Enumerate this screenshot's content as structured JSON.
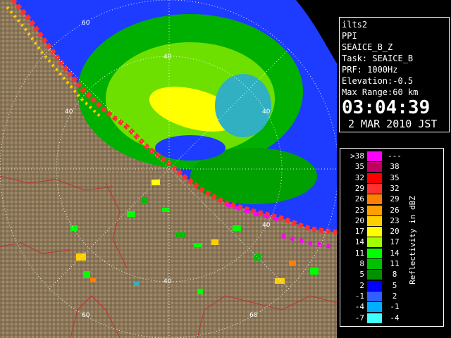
{
  "info": {
    "radar_name": "ilts2",
    "scan_type": "PPI",
    "product": "SEAICE_B_Z",
    "task": "Task: SEAICE_B",
    "prf": "PRF: 1000Hz",
    "elevation": "Elevation:-0.5",
    "max_range": "Max Range:60 km",
    "time": "03:04:39",
    "date": "2 MAR 2010 JST"
  },
  "range_rings": {
    "labels": [
      "60",
      "40",
      "40",
      "40",
      "40",
      "60",
      "60"
    ]
  },
  "legend": {
    "unit_label": "Reflectivity in dBZ",
    "rows": [
      {
        "lo": ">38",
        "hi": "---",
        "color": "#ff00ff"
      },
      {
        "lo": "35",
        "hi": "38",
        "color": "#c00060"
      },
      {
        "lo": "32",
        "hi": "35",
        "color": "#ff0000"
      },
      {
        "lo": "29",
        "hi": "32",
        "color": "#ff3030"
      },
      {
        "lo": "26",
        "hi": "29",
        "color": "#ff8000"
      },
      {
        "lo": "23",
        "hi": "26",
        "color": "#ffa000"
      },
      {
        "lo": "20",
        "hi": "23",
        "color": "#ffd000"
      },
      {
        "lo": "17",
        "hi": "20",
        "color": "#ffff00"
      },
      {
        "lo": "14",
        "hi": "17",
        "color": "#a0ff00"
      },
      {
        "lo": "11",
        "hi": "14",
        "color": "#00ff00"
      },
      {
        "lo": "8",
        "hi": "11",
        "color": "#00c000"
      },
      {
        "lo": "5",
        "hi": "8",
        "color": "#009000"
      },
      {
        "lo": "2",
        "hi": "5",
        "color": "#0000ff"
      },
      {
        "lo": "-1",
        "hi": "2",
        "color": "#3060ff"
      },
      {
        "lo": "-4",
        "hi": "-1",
        "color": "#00b0ff"
      },
      {
        "lo": "-7",
        "hi": "-4",
        "color": "#40ffff"
      }
    ]
  },
  "colors": {
    "land": "#8a7558",
    "sea": "#1e3cff",
    "rings": "#ffffff",
    "boundaries": "#c03030"
  }
}
